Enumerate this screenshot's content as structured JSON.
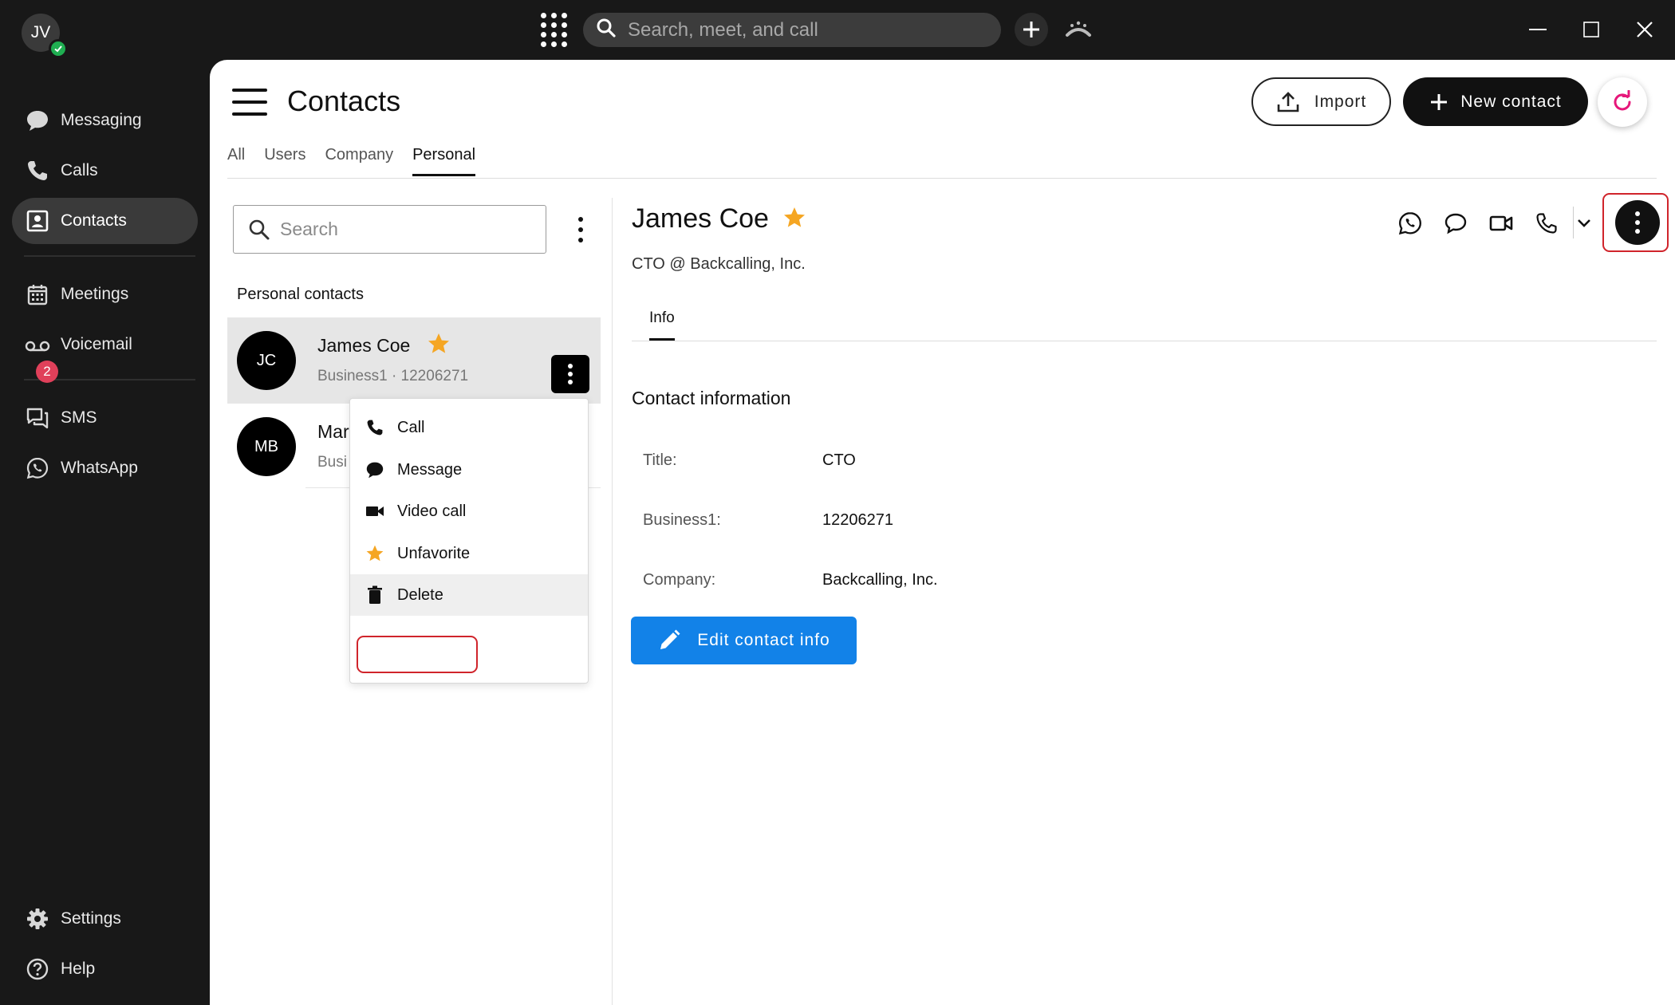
{
  "user": {
    "initials": "JV",
    "presence": "available"
  },
  "topbar": {
    "search_placeholder": "Search, meet, and call"
  },
  "sidebar": {
    "items": [
      {
        "label": "Messaging",
        "icon": "chat-bubble-icon"
      },
      {
        "label": "Calls",
        "icon": "phone-icon"
      },
      {
        "label": "Contacts",
        "icon": "contact-card-icon",
        "active": true
      },
      {
        "label": "Meetings",
        "icon": "calendar-icon"
      },
      {
        "label": "Voicemail",
        "icon": "voicemail-icon",
        "badge": "2"
      },
      {
        "label": "SMS",
        "icon": "sms-icon"
      },
      {
        "label": "WhatsApp",
        "icon": "whatsapp-icon"
      }
    ],
    "bottom": [
      {
        "label": "Settings",
        "icon": "gear-icon"
      },
      {
        "label": "Help",
        "icon": "help-icon"
      }
    ]
  },
  "page": {
    "title": "Contacts",
    "import_label": "Import",
    "new_contact_label": "New contact",
    "tabs": [
      "All",
      "Users",
      "Company",
      "Personal"
    ],
    "active_tab": "Personal"
  },
  "list": {
    "search_placeholder": "Search",
    "section_label": "Personal contacts",
    "contacts": [
      {
        "initials": "JC",
        "name": "James Coe",
        "sub": "Business1 · 12206271",
        "favorite": true,
        "selected": true
      },
      {
        "initials": "MB",
        "name": "Mar",
        "sub": "Busi"
      }
    ]
  },
  "context_menu": {
    "items": [
      {
        "label": "Call",
        "icon": "phone-icon"
      },
      {
        "label": "Message",
        "icon": "chat-bubble-icon"
      },
      {
        "label": "Video call",
        "icon": "video-camera-icon"
      },
      {
        "label": "Unfavorite",
        "icon": "star-icon"
      },
      {
        "label": "Delete",
        "icon": "trash-icon",
        "highlighted": true
      }
    ]
  },
  "detail": {
    "name": "James Coe",
    "subtitle": "CTO @ Backcalling, Inc.",
    "tab": "Info",
    "section_title": "Contact information",
    "fields": [
      {
        "label": "Title:",
        "value": "CTO"
      },
      {
        "label": "Business1:",
        "value": "12206271"
      },
      {
        "label": "Company:",
        "value": "Backcalling, Inc."
      }
    ],
    "edit_label": "Edit contact info"
  },
  "colors": {
    "accent_blue": "#1282e8",
    "favorite_star": "#f5a623",
    "badge_red": "#e0405a",
    "refresh_pink": "#e6177a",
    "highlight_outline": "#d0242b"
  }
}
